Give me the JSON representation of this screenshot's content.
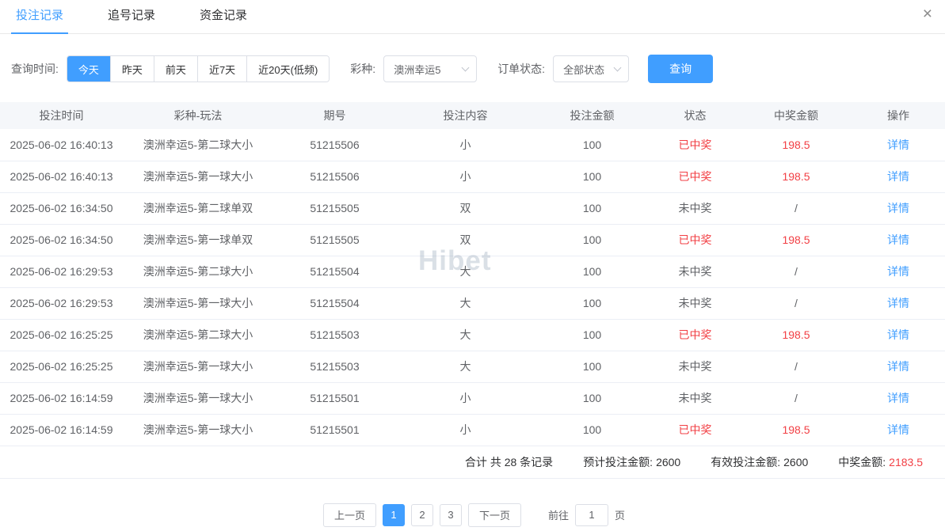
{
  "window": {
    "close_icon": "×"
  },
  "tabs": [
    {
      "label": "投注记录",
      "active": true
    },
    {
      "label": "追号记录",
      "active": false
    },
    {
      "label": "资金记录",
      "active": false
    }
  ],
  "filters": {
    "time_label": "查询时间:",
    "time_options": [
      "今天",
      "昨天",
      "前天",
      "近7天",
      "近20天(低频)"
    ],
    "time_active": "今天",
    "lottery_label": "彩种:",
    "lottery_value": "澳洲幸运5",
    "status_label": "订单状态:",
    "status_value": "全部状态",
    "search_button": "查询"
  },
  "table": {
    "headers": [
      "投注时间",
      "彩种-玩法",
      "期号",
      "投注内容",
      "投注金额",
      "状态",
      "中奖金额",
      "操作"
    ],
    "detail_label": "详情",
    "rows": [
      {
        "time": "2025-06-02 16:40:13",
        "game": "澳洲幸运5-第二球大小",
        "issue": "51215506",
        "content": "小",
        "amount": "100",
        "status": "已中奖",
        "prize": "198.5",
        "win": true
      },
      {
        "time": "2025-06-02 16:40:13",
        "game": "澳洲幸运5-第一球大小",
        "issue": "51215506",
        "content": "小",
        "amount": "100",
        "status": "已中奖",
        "prize": "198.5",
        "win": true
      },
      {
        "time": "2025-06-02 16:34:50",
        "game": "澳洲幸运5-第二球单双",
        "issue": "51215505",
        "content": "双",
        "amount": "100",
        "status": "未中奖",
        "prize": "/",
        "win": false
      },
      {
        "time": "2025-06-02 16:34:50",
        "game": "澳洲幸运5-第一球单双",
        "issue": "51215505",
        "content": "双",
        "amount": "100",
        "status": "已中奖",
        "prize": "198.5",
        "win": true
      },
      {
        "time": "2025-06-02 16:29:53",
        "game": "澳洲幸运5-第二球大小",
        "issue": "51215504",
        "content": "大",
        "amount": "100",
        "status": "未中奖",
        "prize": "/",
        "win": false
      },
      {
        "time": "2025-06-02 16:29:53",
        "game": "澳洲幸运5-第一球大小",
        "issue": "51215504",
        "content": "大",
        "amount": "100",
        "status": "未中奖",
        "prize": "/",
        "win": false
      },
      {
        "time": "2025-06-02 16:25:25",
        "game": "澳洲幸运5-第二球大小",
        "issue": "51215503",
        "content": "大",
        "amount": "100",
        "status": "已中奖",
        "prize": "198.5",
        "win": true
      },
      {
        "time": "2025-06-02 16:25:25",
        "game": "澳洲幸运5-第一球大小",
        "issue": "51215503",
        "content": "大",
        "amount": "100",
        "status": "未中奖",
        "prize": "/",
        "win": false
      },
      {
        "time": "2025-06-02 16:14:59",
        "game": "澳洲幸运5-第一球大小",
        "issue": "51215501",
        "content": "小",
        "amount": "100",
        "status": "未中奖",
        "prize": "/",
        "win": false
      },
      {
        "time": "2025-06-02 16:14:59",
        "game": "澳洲幸运5-第一球大小",
        "issue": "51215501",
        "content": "小",
        "amount": "100",
        "status": "已中奖",
        "prize": "198.5",
        "win": true
      }
    ]
  },
  "summary": {
    "total_text": "合计 共 28 条记录",
    "expected_label": "预计投注金额:",
    "expected_value": "2600",
    "valid_label": "有效投注金额:",
    "valid_value": "2600",
    "prize_label": "中奖金额:",
    "prize_value": "2183.5"
  },
  "pagination": {
    "prev_label": "上一页",
    "pages": [
      "1",
      "2",
      "3"
    ],
    "active_page": "1",
    "next_label": "下一页",
    "goto_label": "前往",
    "goto_value": "1",
    "goto_suffix": "页"
  },
  "watermark": "Hibet",
  "colors": {
    "accent": "#409eff",
    "win_red": "#f23f44",
    "link": "#409eff"
  }
}
